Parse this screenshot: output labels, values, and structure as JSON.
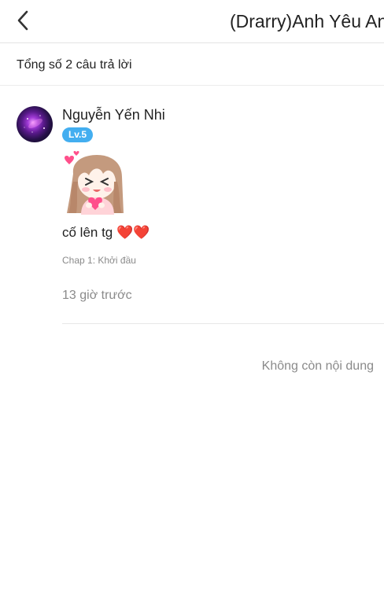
{
  "header": {
    "title": "(Drarry)Anh Yêu Anh",
    "back_icon": "chevron-left-icon"
  },
  "summary": {
    "count_text": "Tổng số 2 câu trả lời"
  },
  "comments": [
    {
      "author": "Nguyễn Yến Nhi",
      "level": "Lv.5",
      "text": "cố lên tg ❤️❤️",
      "chapter": "Chap 1: Khởi đầu",
      "time": "13 giờ trước",
      "sticker": "girl-sticker"
    }
  ],
  "footer": {
    "end_text": "Không còn nội dung"
  },
  "colors": {
    "accent": "#43aef0",
    "muted_text": "#8a8a8a",
    "divider": "#e8e8e8"
  }
}
